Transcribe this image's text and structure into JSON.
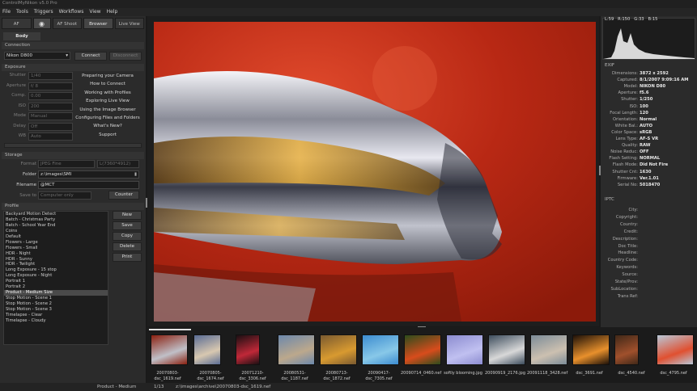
{
  "window": {
    "title": "ControlMyNikon v5.0 Pro"
  },
  "menu": [
    "File",
    "Tools",
    "Triggers",
    "Workflows",
    "View",
    "Help"
  ],
  "left_tabs": {
    "af": "AF",
    "af_shoot": "AF Shoot",
    "browser": "Browser",
    "live_view": "Live View"
  },
  "sub_tab": "Body",
  "connection": {
    "header": "Connection",
    "camera": "Nikon D800",
    "connect": "Connect",
    "disconnect": "Disconnect"
  },
  "exposure": {
    "header": "Exposure",
    "fields": [
      {
        "label": "Shutter",
        "value": "1/40"
      },
      {
        "label": "Aperture",
        "value": "f/ 8"
      },
      {
        "label": "Comp.",
        "value": "0.00"
      },
      {
        "label": "ISO",
        "value": "200"
      },
      {
        "label": "Mode",
        "value": "Manual"
      },
      {
        "label": "Delay",
        "value": "Off"
      },
      {
        "label": "WB",
        "value": "Auto"
      }
    ]
  },
  "help_links": [
    "Preparing your Camera",
    "How to Connect",
    "Working with Profiles",
    "Exploring Live View",
    "Using the Image Browser",
    "Configuring Files and Folders",
    "What's New?",
    "Support"
  ],
  "storage": {
    "header": "Storage",
    "format_label": "Format",
    "format_value": "JPEG Fine",
    "size_value": "L(7360*4912)",
    "folder_label": "Folder",
    "folder_value": "z:\\images\\SMI",
    "filename_label": "Filename",
    "filename_value": "@MCT",
    "saveto_label": "Save to",
    "saveto_value": "Computer only",
    "counter": "Counter"
  },
  "profile": {
    "header": "Profile",
    "items": [
      "Backyard Motion Detect",
      "Batch - Christmas Party",
      "Batch - School Year End",
      "Coins",
      "Default",
      "Flowers - Large",
      "Flowers - Small",
      "HDR - Night",
      "HDR - Sunny",
      "HDR - Twilight",
      "Long Exposure - 15 stop",
      "Long Exposure - Night",
      "Portrait 1",
      "Portrait 2",
      "Product - Medium Size",
      "Stop Motion - Scene 1",
      "Stop Motion - Scene 2",
      "Stop Motion - Scene 3",
      "Timelapse - Clear",
      "Timelapse - Cloudy"
    ],
    "selected_index": 14,
    "buttons": [
      "New",
      "Save",
      "Copy",
      "Delete",
      "Print"
    ]
  },
  "histogram": {
    "readout": "L:59   R:150   G:33   B:15"
  },
  "exif": {
    "header": "EXIF",
    "rows": [
      {
        "label": "Dimensions:",
        "value": "3872 x 2592"
      },
      {
        "label": "Captured:",
        "value": "8/1/2007 9:09:16 AM"
      },
      {
        "label": "Model:",
        "value": "NIKON D80"
      },
      {
        "label": "Aperture:",
        "value": "f5.6"
      },
      {
        "label": "Shutter:",
        "value": "1/250"
      },
      {
        "label": "ISO:",
        "value": "100"
      },
      {
        "label": "Focal Length:",
        "value": "120"
      },
      {
        "label": "Orientation:",
        "value": "Normal"
      },
      {
        "label": "White Bal.:",
        "value": "AUTO"
      },
      {
        "label": "Color Space:",
        "value": "sRGB"
      },
      {
        "label": "Lens Type:",
        "value": "AF-S VR"
      },
      {
        "label": "Quality:",
        "value": "RAW"
      },
      {
        "label": "Noise Reduc:",
        "value": "OFF"
      },
      {
        "label": "Flash Setting:",
        "value": "NORMAL"
      },
      {
        "label": "Flash Mode:",
        "value": "Did Not Fire"
      },
      {
        "label": "Shutter Cnt:",
        "value": "1630"
      },
      {
        "label": "Firmware:",
        "value": "Ver.1.01"
      },
      {
        "label": "Serial No:",
        "value": "5018470"
      }
    ]
  },
  "iptc": {
    "header": "IPTC",
    "rows": [
      {
        "label": "City:",
        "value": ""
      },
      {
        "label": "Copyright:",
        "value": ""
      },
      {
        "label": "Country:",
        "value": ""
      },
      {
        "label": "Credit:",
        "value": ""
      },
      {
        "label": "Description:",
        "value": ""
      },
      {
        "label": "Doc Title:",
        "value": ""
      },
      {
        "label": "Headline:",
        "value": ""
      },
      {
        "label": "Country Code:",
        "value": ""
      },
      {
        "label": "Keywords:",
        "value": ""
      },
      {
        "label": "Source:",
        "value": ""
      },
      {
        "label": "State/Prov:",
        "value": ""
      },
      {
        "label": "SubLocation:",
        "value": ""
      },
      {
        "label": "Trans Ref:",
        "value": ""
      }
    ]
  },
  "thumbnails": [
    {
      "name": "20070803-dsc_1619.nef",
      "colors": [
        "#8a2010",
        "#c0c0c8"
      ]
    },
    {
      "name": "20070805-dsc_1674.nef",
      "colors": [
        "#5a6c94",
        "#d8c8b0"
      ]
    },
    {
      "name": "20071210-dsc_3306.nef",
      "colors": [
        "#1a0f12",
        "#c02838"
      ]
    },
    {
      "name": "20080531-dsc_1187.nef",
      "colors": [
        "#6c88ac",
        "#bca88c"
      ]
    },
    {
      "name": "20080713-dsc_1872.nef",
      "colors": [
        "#7a5a30",
        "#d89a30"
      ]
    },
    {
      "name": "20090417-dsc_7305.nef",
      "colors": [
        "#3c8cd0",
        "#88c8e8"
      ]
    },
    {
      "name": "20090714_0460.nef",
      "colors": [
        "#2c4c1c",
        "#d84c1c"
      ]
    },
    {
      "name": "softly blooming.jpg",
      "colors": [
        "#8c8cd0",
        "#c0c0f0"
      ]
    },
    {
      "name": "20090919_2176.jpg",
      "colors": [
        "#3c4c5c",
        "#d8d8d8"
      ]
    },
    {
      "name": "20091118_3428.nef",
      "colors": [
        "#7c8c98",
        "#ccc0b0"
      ]
    },
    {
      "name": "dsc_3691.nef",
      "colors": [
        "#1c1008",
        "#e8902c"
      ]
    },
    {
      "name": "dsc_4540.nef",
      "colors": [
        "#402818",
        "#a0502c"
      ]
    },
    {
      "name": "dsc_4795.nef",
      "colors": [
        "#b8c8d8",
        "#e05030"
      ]
    }
  ],
  "status": {
    "profile": "Product - Medium Size",
    "counter": "1/13",
    "path": "z:\\images\\archive\\20070803-dsc_1619.nef"
  },
  "colors": {
    "bg": "#2b2b2b",
    "accent_photo": "#c8321a",
    "selection": "#4a4a4a"
  }
}
